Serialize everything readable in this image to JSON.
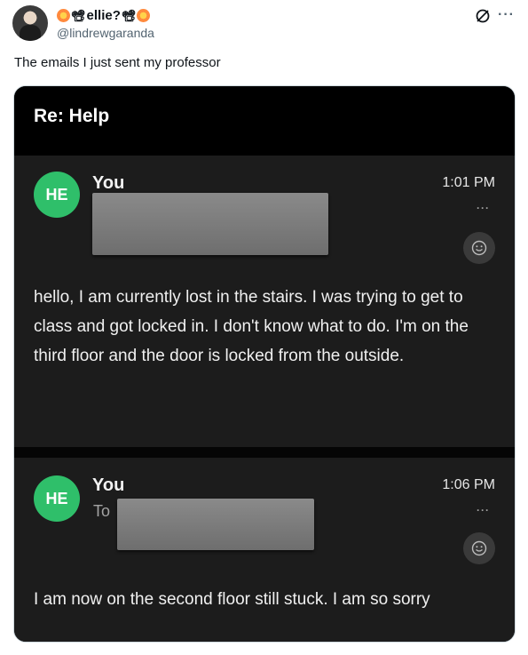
{
  "tweet": {
    "display_name": "ellie?",
    "handle": "@lindrewgaranda",
    "text": "The emails I just sent my professor",
    "icons": [
      "grok-icon",
      "more-icon"
    ]
  },
  "email": {
    "subject": "Re: Help",
    "messages": [
      {
        "avatar_initials": "HE",
        "sender": "You",
        "to_label": "",
        "time": "1:01 PM",
        "body": "hello, I am currently lost in the stairs. I was trying to get to class and got locked in. I don't know what to do. I'm on the third floor and the door is locked from the outside."
      },
      {
        "avatar_initials": "HE",
        "sender": "You",
        "to_label": "To",
        "time": "1:06 PM",
        "body": "I am now on the second floor still stuck. I am so sorry"
      }
    ],
    "colors": {
      "avatar_green": "#2fbf6a",
      "background": "#1c1c1c",
      "header": "#000000"
    }
  }
}
